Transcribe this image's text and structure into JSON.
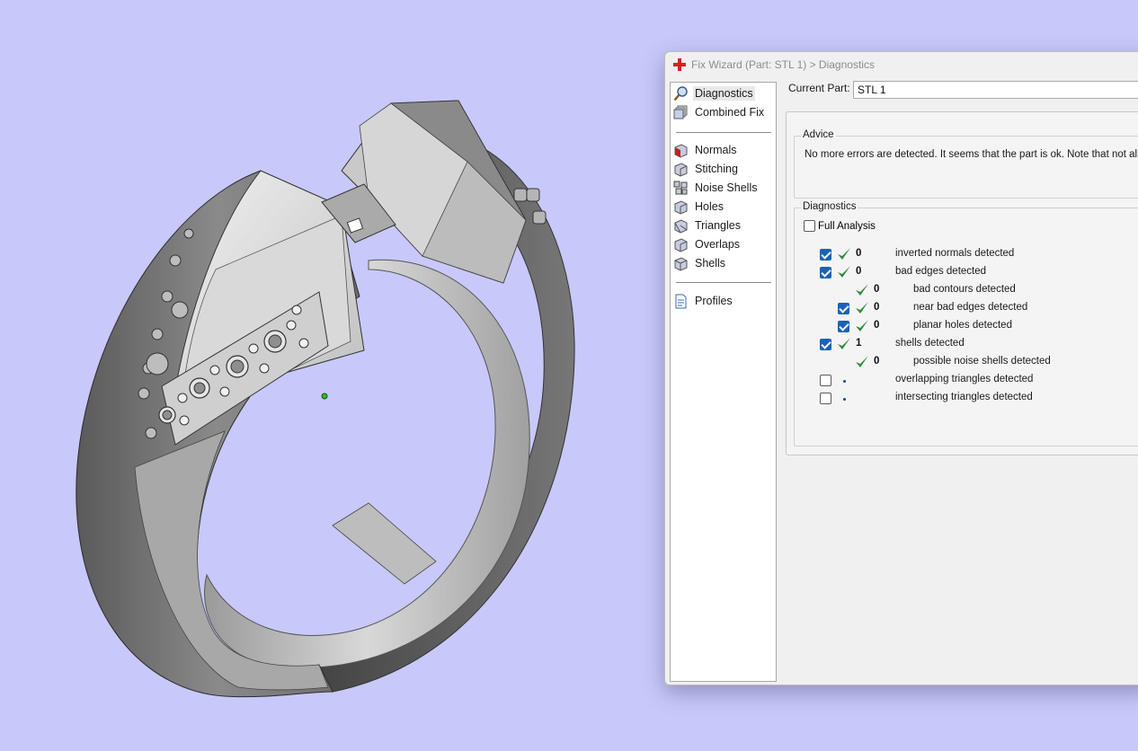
{
  "window": {
    "title": "Fix Wizard (Part: STL 1) > Diagnostics"
  },
  "nav": {
    "items": [
      {
        "label": "Diagnostics",
        "icon": "magnifier-icon",
        "selected": true
      },
      {
        "label": "Combined Fix",
        "icon": "layers-icon"
      },
      {
        "label": "Normals",
        "icon": "normals-cube-icon"
      },
      {
        "label": "Stitching",
        "icon": "stitching-cube-icon"
      },
      {
        "label": "Noise Shells",
        "icon": "noise-shells-icon"
      },
      {
        "label": "Holes",
        "icon": "holes-cube-icon"
      },
      {
        "label": "Triangles",
        "icon": "triangles-cube-icon"
      },
      {
        "label": "Overlaps",
        "icon": "overlaps-cube-icon"
      },
      {
        "label": "Shells",
        "icon": "shells-cube-icon"
      },
      {
        "label": "Profiles",
        "icon": "document-icon"
      }
    ]
  },
  "current_part": {
    "label": "Current Part:",
    "value": "STL 1"
  },
  "advice": {
    "title": "Advice",
    "text": "No more errors are detected. It seems that the part is ok. Note that not all pa"
  },
  "diagnostics": {
    "title": "Diagnostics",
    "full_analysis": {
      "label": "Full Analysis",
      "checked": false
    },
    "rows": [
      {
        "checkbox": "checked",
        "status": "ok",
        "count": "0",
        "label": "inverted normals detected",
        "indent": 0
      },
      {
        "checkbox": "checked",
        "status": "ok",
        "count": "0",
        "label": "bad edges detected",
        "indent": 0
      },
      {
        "checkbox": "none",
        "status": "ok",
        "count": "0",
        "label": "bad contours detected",
        "indent": 1
      },
      {
        "checkbox": "checked",
        "status": "ok",
        "count": "0",
        "label": "near bad edges detected",
        "indent": 1
      },
      {
        "checkbox": "checked",
        "status": "ok",
        "count": "0",
        "label": "planar holes detected",
        "indent": 1
      },
      {
        "checkbox": "checked",
        "status": "ok",
        "count": "1",
        "label": "shells detected",
        "indent": 0
      },
      {
        "checkbox": "none",
        "status": "ok",
        "count": "0",
        "label": "possible noise shells detected",
        "indent": 1
      },
      {
        "checkbox": "unchecked",
        "status": "pending",
        "count": "",
        "label": "overlapping triangles detected",
        "indent": 0
      },
      {
        "checkbox": "unchecked",
        "status": "pending",
        "count": "",
        "label": "intersecting triangles detected",
        "indent": 0
      }
    ]
  },
  "colors": {
    "viewport_bg": "#c8c8fa",
    "check_green": "#2e8b3a",
    "checkbox_blue": "#1a62b8",
    "title_cross_red": "#d42020"
  }
}
